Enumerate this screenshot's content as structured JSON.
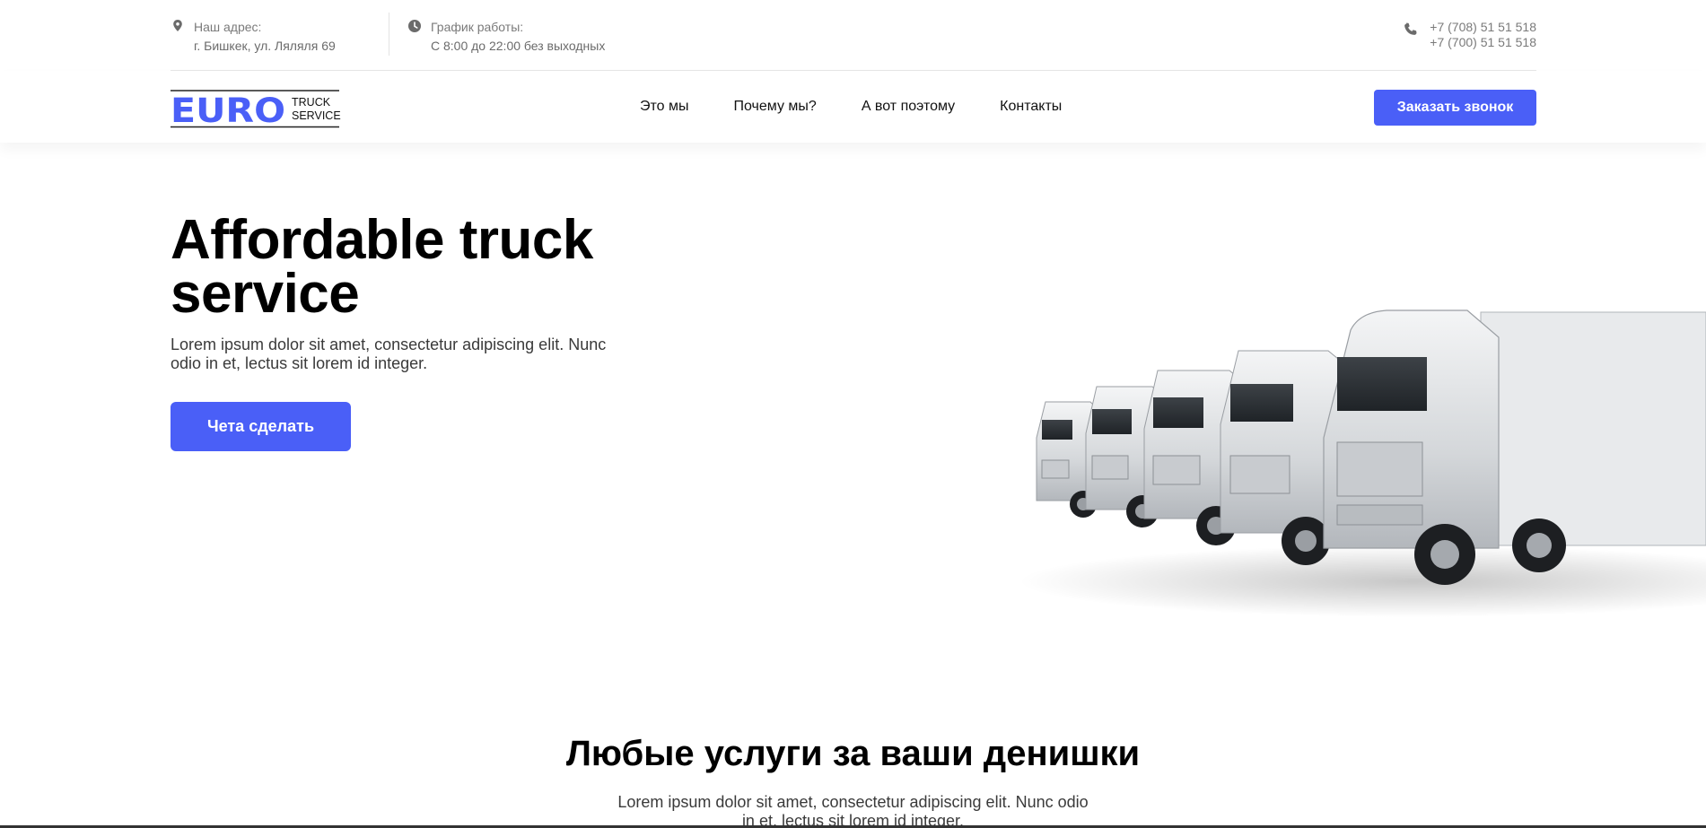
{
  "topbar": {
    "address": {
      "label": "Наш адрес:",
      "value": "г. Бишкек, ул. Ляляля 69",
      "icon": "location-pin-icon"
    },
    "hours": {
      "label": "График работы:",
      "value": "С 8:00 до 22:00 без выходных",
      "icon": "clock-icon"
    },
    "phones": {
      "icon": "phone-icon",
      "primary": "+7 (708) 51 51 518",
      "secondary": "+7 (700) 51 51 518"
    }
  },
  "header": {
    "logo": {
      "word": "EURO",
      "line1": "TRUCK",
      "line2": "SERVICE"
    },
    "nav": [
      "Это мы",
      "Почему мы?",
      "А вот поэтому",
      "Контакты"
    ],
    "cta_label": "Заказать звонок"
  },
  "hero": {
    "title": "Affordable truck service",
    "text": "Lorem ipsum dolor sit amet, consectetur adipiscing elit. Nunc odio in et, lectus sit lorem id integer.",
    "button_label": "Чета сделать"
  },
  "services": {
    "title": "Любые услуги за ваши денишки",
    "text": "Lorem ipsum dolor sit amet, consectetur adipiscing elit. Nunc odio in et, lectus sit lorem id integer."
  },
  "colors": {
    "accent": "#4a5ff7",
    "text": "#111111",
    "muted": "#7a7a7a"
  }
}
